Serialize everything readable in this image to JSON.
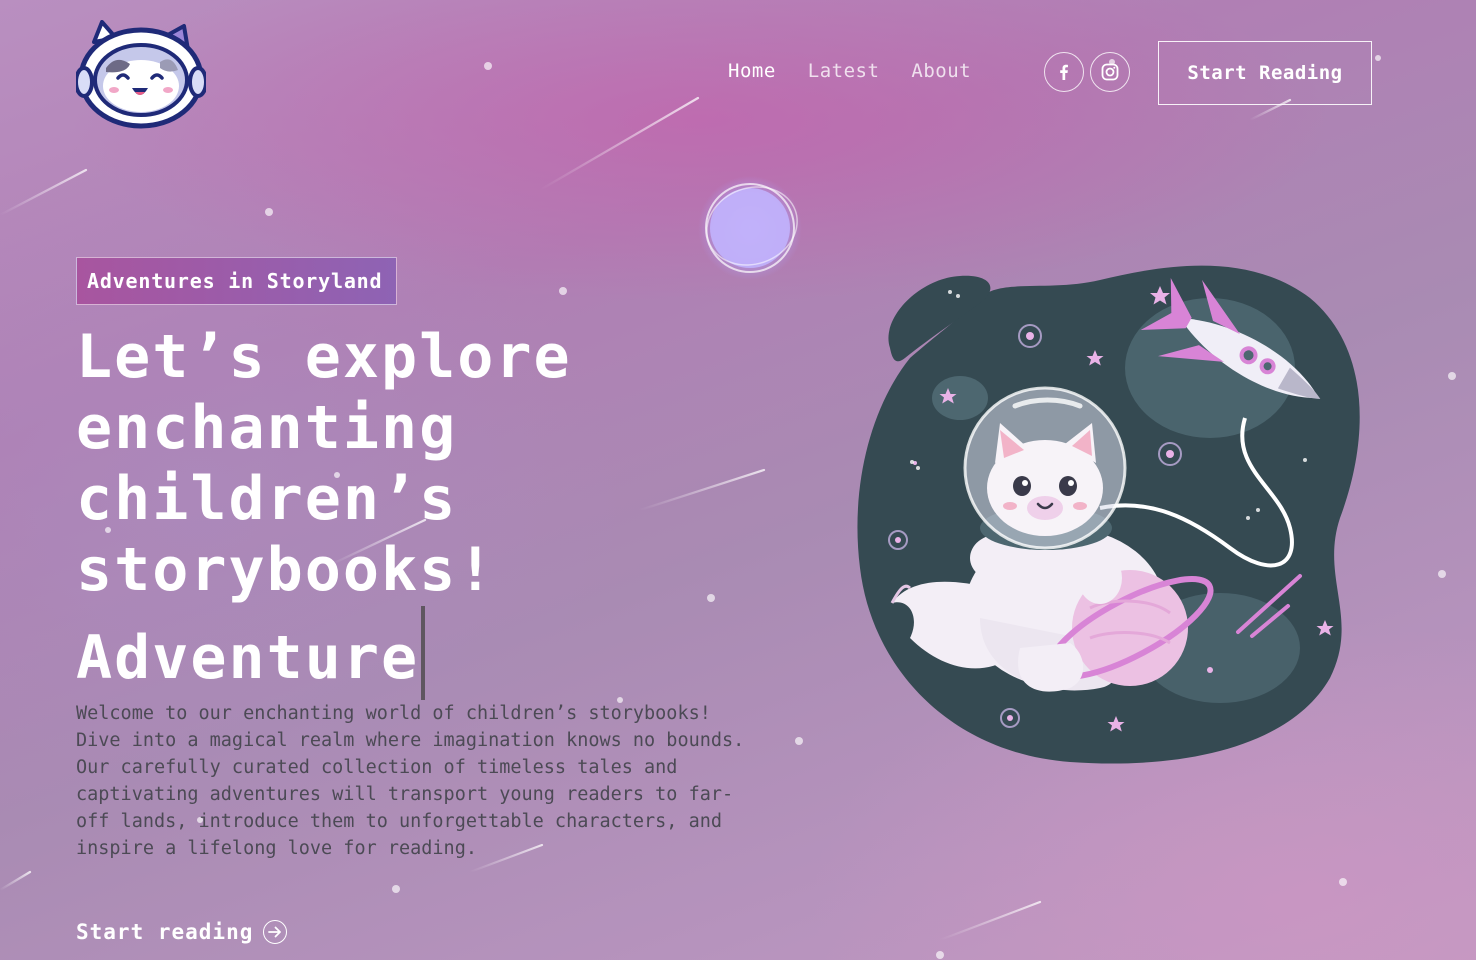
{
  "header": {
    "logo": "astronaut-cat-logo",
    "nav": [
      {
        "label": "Home",
        "active": true
      },
      {
        "label": "Latest",
        "active": false
      },
      {
        "label": "About",
        "active": false
      }
    ],
    "social": [
      {
        "icon": "facebook-icon"
      },
      {
        "icon": "instagram-icon"
      }
    ],
    "cta_label": "Start Reading"
  },
  "hero": {
    "tag": "Adventures in Storyland",
    "headline_lines": [
      "Let’s explore",
      "enchanting",
      "children’s",
      "storybooks!"
    ],
    "typed_word": "Adventure",
    "description": "Welcome to our enchanting world of children’s storybooks!\nDive into a magical realm where imagination knows no bounds.\nOur carefully curated collection of timeless tales and\ncaptivating adventures will transport young readers to far-\noff lands, introduce them to unforgettable characters, and\ninspire a lifelong love for reading.",
    "link_label": "Start reading",
    "illustration": "astronaut-cat-space-illustration"
  },
  "colors": {
    "tag_start": "#a8559f",
    "tag_end": "#8e63b4",
    "blob": "#354a52",
    "text_muted": "#4c4a55",
    "accent_pink": "#d884d6"
  }
}
